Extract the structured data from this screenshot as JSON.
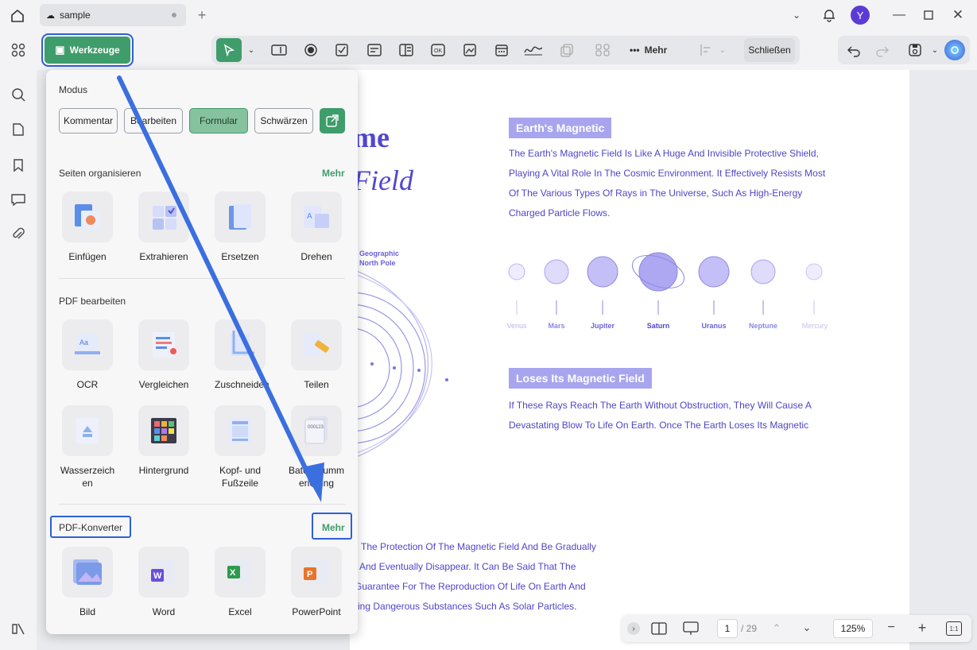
{
  "window": {
    "tab_title": "sample",
    "avatar_letter": "Y"
  },
  "toolbar": {
    "werkzeuge": "Werkzeuge",
    "mehr": "Mehr",
    "schliessen": "Schließen"
  },
  "panel": {
    "modus_title": "Modus",
    "modes": [
      "Kommentar",
      "Bearbeiten",
      "Formular",
      "Schwärzen"
    ],
    "seiten_title": "Seiten organisieren",
    "seiten_more": "Mehr",
    "seiten": [
      "Einfügen",
      "Extrahieren",
      "Ersetzen",
      "Drehen"
    ],
    "pdf_title": "PDF bearbeiten",
    "pdf_edit": [
      "OCR",
      "Vergleichen",
      "Zuschneiden",
      "Teilen",
      "Wasserzeichen",
      "Hintergrund",
      "Kopf- und Fußzeile",
      "Bates-Nummerierung"
    ],
    "konv_title": "PDF-Konverter",
    "konv_more": "Mehr",
    "konv": [
      "Bild",
      "Word",
      "Excel",
      "PowerPoint"
    ]
  },
  "document": {
    "heading1": "me",
    "heading2": "Field",
    "badge1": "Earth's Magnetic",
    "para1": [
      "The Earth's Magnetic Field Is Like A Huge And Invisible Protective Shield,",
      "Playing A Vital Role In The Cosmic Environment. It Effectively Resists Most",
      "Of The Various Types Of Rays in The Universe, Such As High-Energy",
      "Charged Particle Flows."
    ],
    "planets": [
      "Venus",
      "Mars",
      "Jupiter",
      "Saturn",
      "Uranus",
      "Neptune",
      "Mercury"
    ],
    "pole_label": [
      "Geographic",
      "North Pole"
    ],
    "badge2": "Loses Its Magnetic Field",
    "para2": [
      "If These Rays Reach The Earth Without Obstruction, They Will Cause A",
      "Devastating Blow To Life On Earth. Once The Earth Loses Its Magnetic"
    ],
    "para3": [
      "The Protection Of The Magnetic Field And Be Gradually",
      "And Eventually Disappear. It Can Be Said That The",
      "Guarantee For The Reproduction Of Life On Earth And",
      "ing Dangerous Substances Such As Solar Particles."
    ]
  },
  "status": {
    "page": "1",
    "total": "/ 29",
    "zoom": "125%"
  },
  "colors": {
    "accent": "#3f9d6b",
    "highlight": "#2f5fd6",
    "doc_text": "#4f45c9"
  }
}
